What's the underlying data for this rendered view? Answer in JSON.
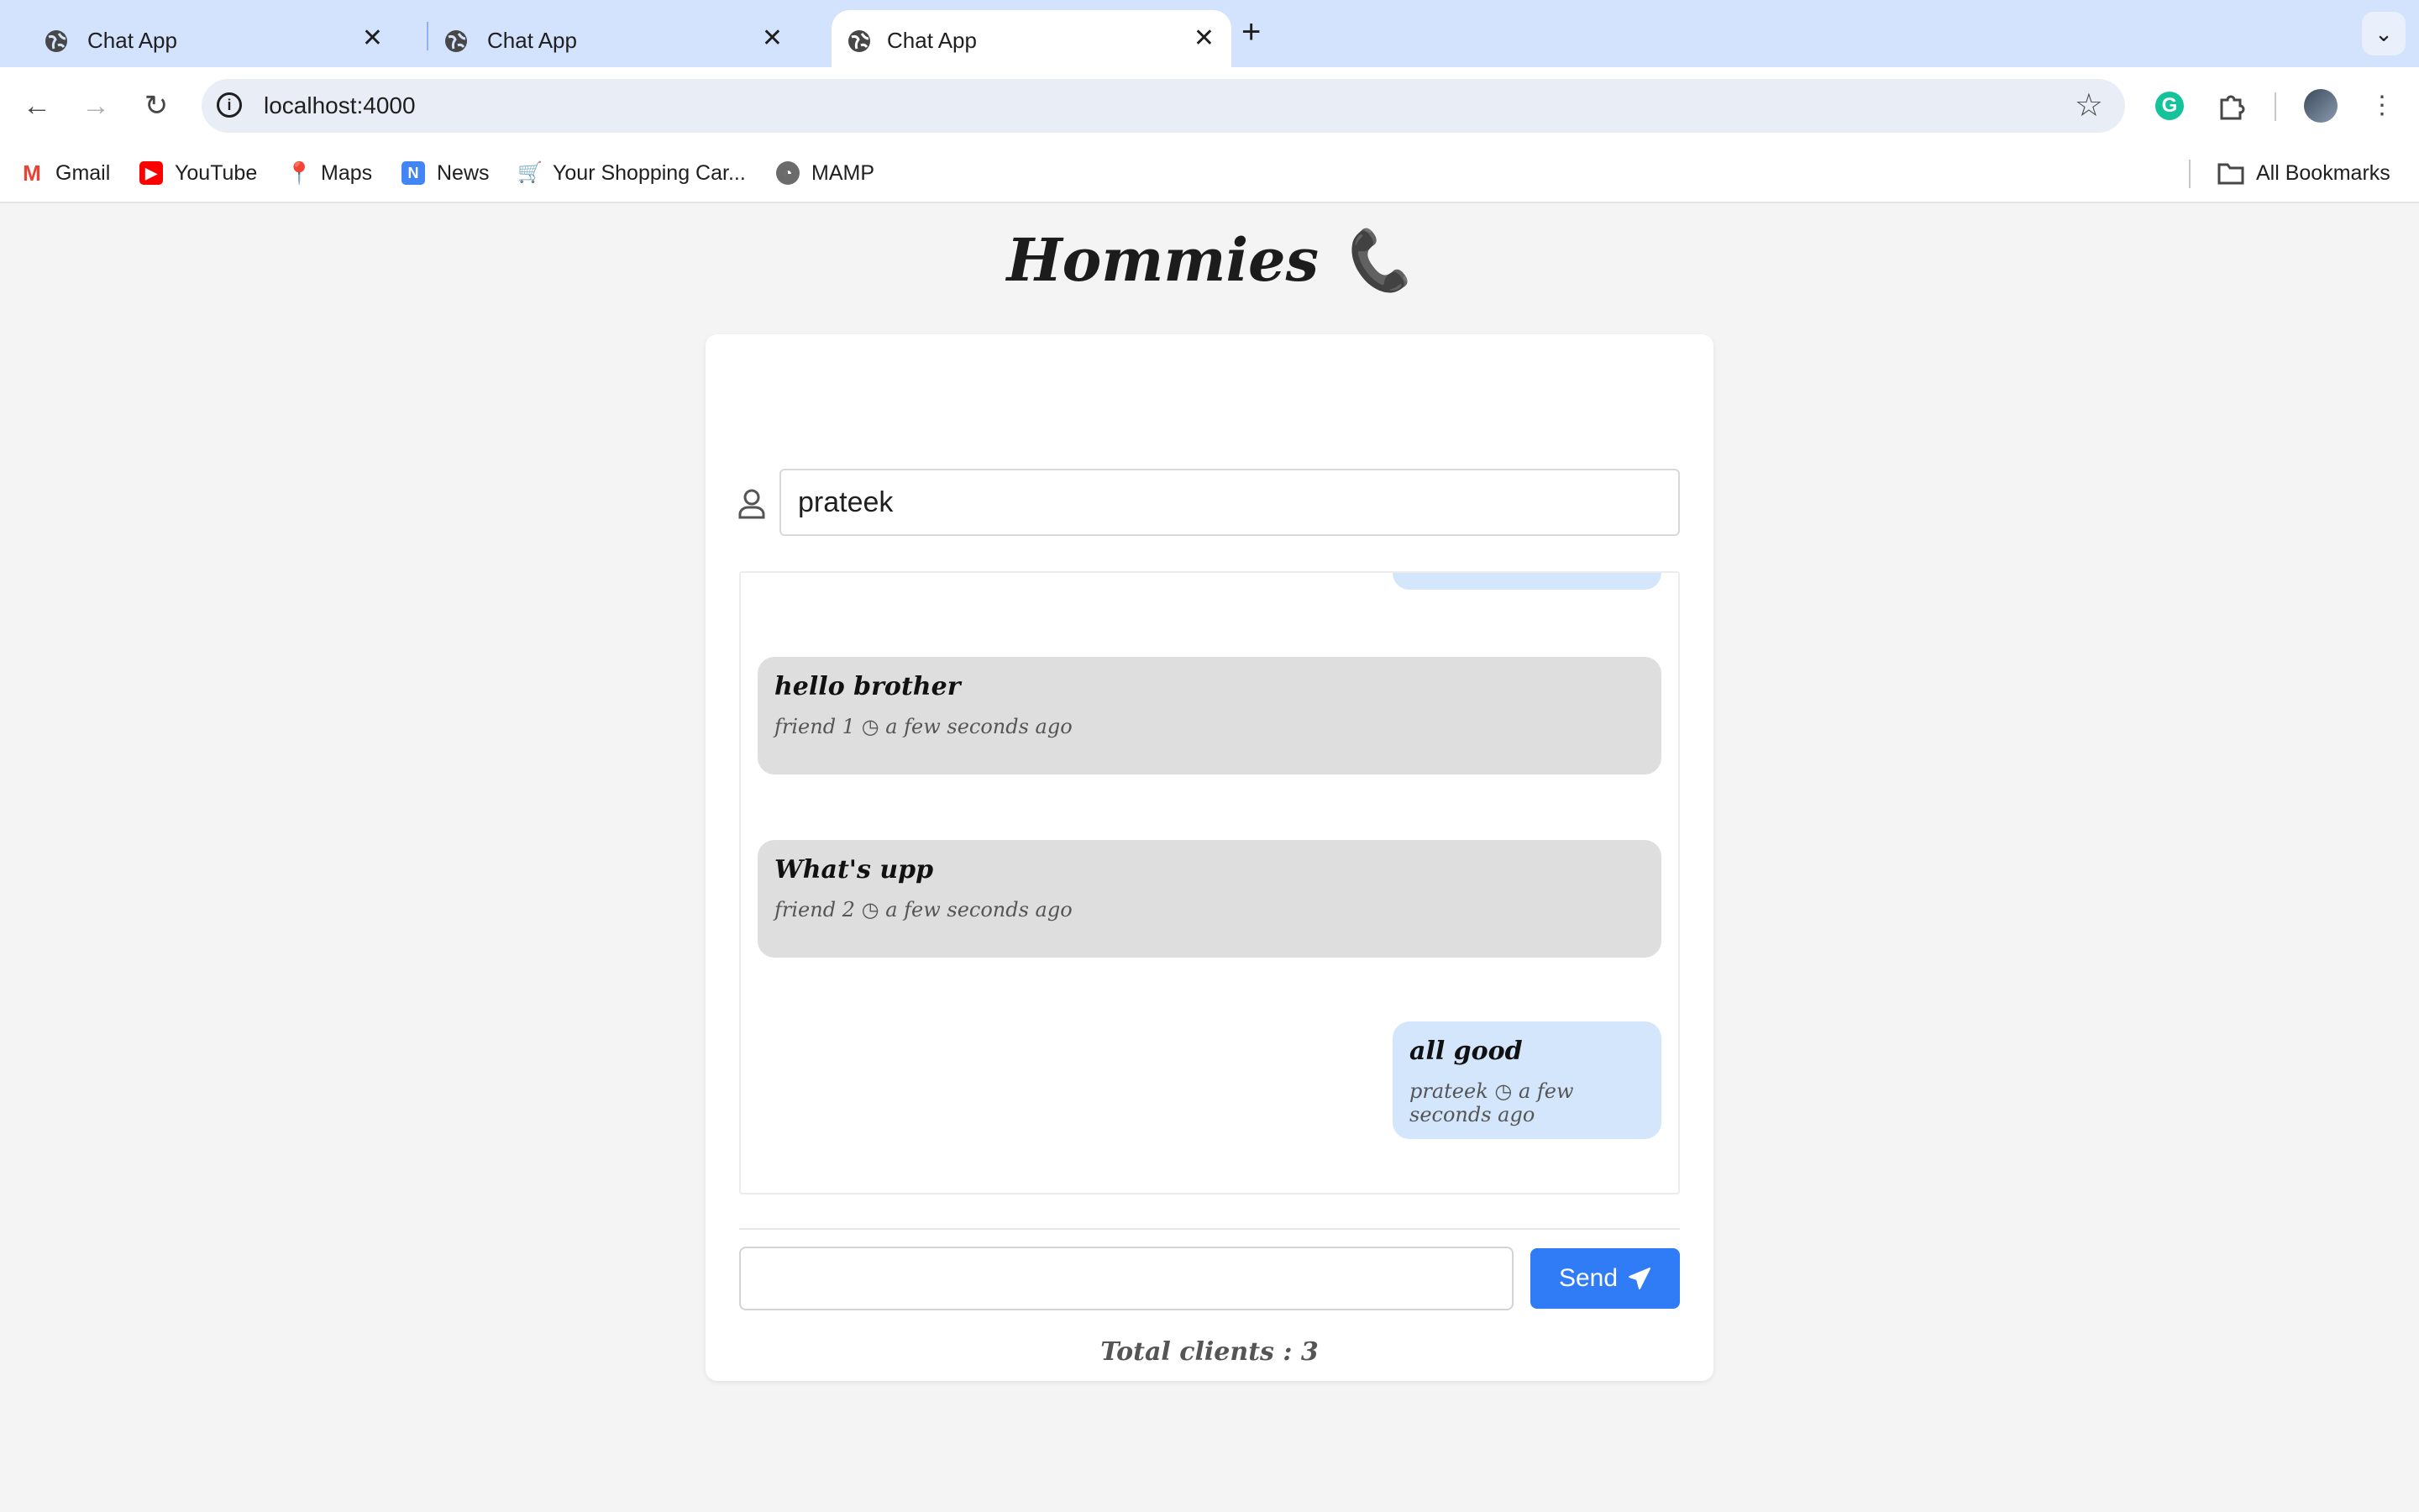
{
  "browser": {
    "tabs": [
      {
        "title": "Chat App",
        "active": false
      },
      {
        "title": "Chat App",
        "active": false
      },
      {
        "title": "Chat App",
        "active": true
      }
    ],
    "url": "localhost:4000",
    "bookmarks": [
      {
        "label": "Gmail",
        "icon": "gmail-icon"
      },
      {
        "label": "YouTube",
        "icon": "youtube-icon"
      },
      {
        "label": "Maps",
        "icon": "maps-icon"
      },
      {
        "label": "News",
        "icon": "news-icon"
      },
      {
        "label": "Your Shopping Car...",
        "icon": "cart-icon"
      },
      {
        "label": "MAMP",
        "icon": "mamp-icon"
      }
    ],
    "all_bookmarks_label": "All Bookmarks"
  },
  "app": {
    "title": "Hommies 📞",
    "username": "prateek",
    "messages": [
      {
        "text": "hello brother",
        "sender": "friend 1",
        "time": "a few seconds ago",
        "side": "left"
      },
      {
        "text": "What's upp",
        "sender": "friend 2",
        "time": "a few seconds ago",
        "side": "left"
      },
      {
        "text": "all good",
        "sender": "prateek",
        "time": "a few seconds ago",
        "side": "right"
      }
    ],
    "send_label": "Send",
    "total_clients": "Total clients : 3"
  },
  "colors": {
    "accent": "#2f7cf6",
    "own_message_bg": "#d3e6fb",
    "other_message_bg": "#dedede",
    "tabstrip_bg": "#d3e3fd"
  }
}
